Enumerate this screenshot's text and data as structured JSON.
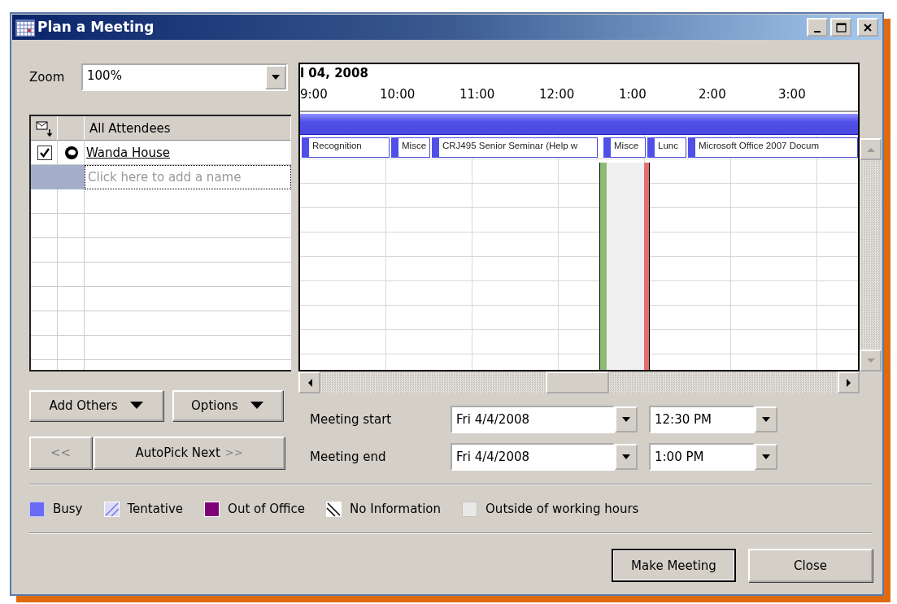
{
  "window": {
    "title": "Plan a Meeting"
  },
  "zoom": {
    "label": "Zoom",
    "value": "100%"
  },
  "attendees": {
    "header": "All Attendees",
    "rows": [
      {
        "name": "Wanda House",
        "checked": true
      }
    ],
    "new_row": {
      "placeholder": "Click here to add a name"
    }
  },
  "timeline": {
    "date": "l 04, 2008",
    "hours": [
      "9:00",
      "10:00",
      "11:00",
      "12:00",
      "1:00",
      "2:00",
      "3:00"
    ],
    "events": [
      {
        "title": "Recognition"
      },
      {
        "title": "Misce"
      },
      {
        "title": "CRJ495 Senior Seminar (Help w"
      },
      {
        "title": "Misce"
      },
      {
        "title": "Lunc"
      },
      {
        "title": "Microsoft Office 2007 Docum"
      }
    ]
  },
  "buttons_left": [
    {
      "label": "Add Others"
    },
    {
      "label": "Options"
    }
  ],
  "autopick": {
    "previous": {
      "label": "<<",
      "disabled": true
    },
    "next": {
      "label": "AutoPick Next",
      "arrows": ">>"
    }
  },
  "meeting": [
    {
      "label": "Meeting start",
      "date": "Fri 4/4/2008",
      "time": "12:30 PM"
    },
    {
      "label": "Meeting end",
      "date": "Fri 4/4/2008",
      "time": "1:00 PM"
    }
  ],
  "legend": [
    {
      "label": "Busy",
      "kind": "busy"
    },
    {
      "label": "Tentative",
      "kind": "tentative"
    },
    {
      "label": "Out of Office",
      "kind": "out_of_office"
    },
    {
      "label": "No Information",
      "kind": "no_info"
    },
    {
      "label": "Outside of working hours",
      "kind": "outside"
    }
  ],
  "buttons_bottom": [
    {
      "label": "Make Meeting",
      "default": true
    },
    {
      "label": "Close",
      "default": false
    }
  ]
}
